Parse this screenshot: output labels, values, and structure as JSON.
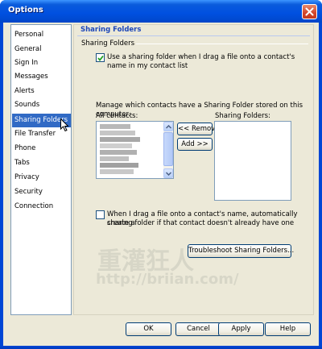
{
  "window": {
    "title": "Options",
    "colors": {
      "titlebar": "#0050e0",
      "accent": "#316ac5",
      "heading": "#1d47b8"
    }
  },
  "nav": {
    "items": [
      {
        "label": "Personal"
      },
      {
        "label": "General"
      },
      {
        "label": "Sign In"
      },
      {
        "label": "Messages"
      },
      {
        "label": "Alerts"
      },
      {
        "label": "Sounds"
      },
      {
        "label": "Sharing Folders"
      },
      {
        "label": "File Transfer"
      },
      {
        "label": "Phone"
      },
      {
        "label": "Tabs"
      },
      {
        "label": "Privacy"
      },
      {
        "label": "Security"
      },
      {
        "label": "Connection"
      }
    ],
    "selected": "Sharing Folders"
  },
  "panel": {
    "heading": "Sharing Folders",
    "group_label": "Sharing Folders",
    "option1": {
      "checked": true,
      "line1": "Use a sharing folder when I drag a file onto a contact's",
      "line2": "name in my contact list"
    },
    "manage_text": "Manage which contacts have a Sharing Folder stored on this computer.",
    "all_contacts_label": "All contacts:",
    "sharing_folders_label": "Sharing Folders:",
    "remove_button": "<< Remove",
    "add_button": "Add >>",
    "option2": {
      "checked": false,
      "line1": "When I drag a file onto a contact's name, automatically create a",
      "line2": "sharing folder if that contact doesn't already have one"
    },
    "troubleshoot_button": "Troubleshoot Sharing Folders..."
  },
  "watermark": {
    "text": "重灌狂人",
    "url": "http://briian.com/"
  },
  "footer": {
    "ok": "OK",
    "cancel": "Cancel",
    "apply": "Apply",
    "help": "Help"
  }
}
